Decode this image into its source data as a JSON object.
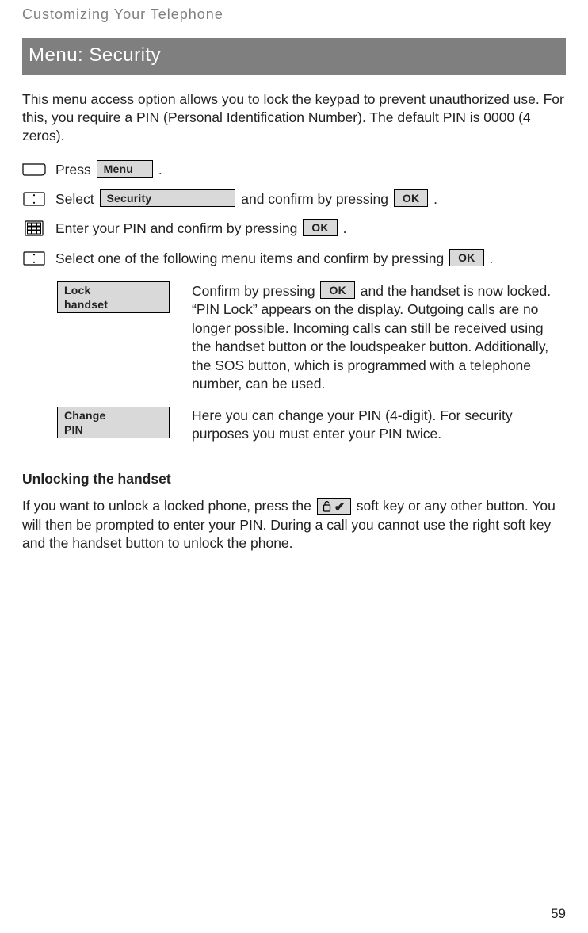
{
  "header": {
    "section": "Customizing Your Telephone"
  },
  "title_bar": "Menu: Security",
  "intro": "This menu access option allows you to lock the keypad to prevent unauthorized use. For this, you require a PIN (Personal Identification Number). The default PIN is 0000 (4 zeros).",
  "buttons": {
    "menu": "Menu",
    "security": "Security",
    "ok": "OK",
    "lock_handset": "Lock handset",
    "change_pin": "Change PIN"
  },
  "steps": {
    "press_pre": "Press ",
    "press_post": " .",
    "select_pre": "Select ",
    "select_mid": " and confirm by pressing ",
    "select_post": " .",
    "enter_pin_pre": "Enter your PIN and confirm by pressing ",
    "enter_pin_post": " .",
    "select_item_pre": "Select one of the following menu items and confirm by pressing ",
    "select_item_post": " ."
  },
  "options": {
    "lock_pre": "Confirm by pressing ",
    "lock_post": " and the handset is now locked. “PIN Lock” appears on the display. Outgoing calls are no longer possible. Inco­ming calls can still be received using the handset button or the loud­speaker button. Additionally, the SOS button, which is programmed with a telephone number, can be used.",
    "change_pin_text": "Here you can change your PIN (4-digit). For security purposes you must enter your PIN twice."
  },
  "unlock": {
    "heading": "Unlocking the handset",
    "pre": "If you want to unlock a locked phone, press the ",
    "post": " soft key or any other button. You will then be prompted to enter your PIN. During a call you cannot use the right soft key and the handset button to unlock the phone."
  },
  "page_number": "59",
  "icons": {
    "softkey_key": "softkey-icon",
    "nav_key": "nav-key-icon",
    "keypad": "keypad-icon",
    "unlock_softkey": "unlock-softkey-icon"
  }
}
